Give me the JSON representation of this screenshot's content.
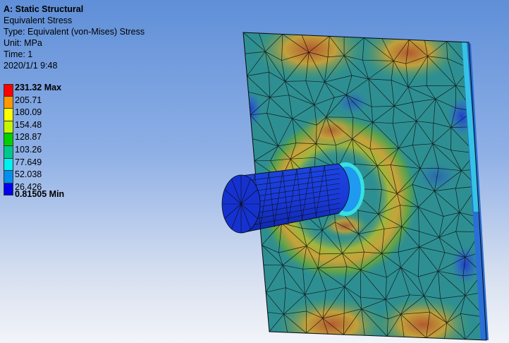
{
  "info": {
    "title": "A: Static Structural",
    "result": "Equivalent Stress",
    "type": "Type: Equivalent (von-Mises) Stress",
    "unit": "Unit: MPa",
    "time": "Time: 1",
    "timestamp": "2020/1/1 9:48"
  },
  "legend": {
    "max_label": "231.32 Max",
    "levels": [
      "205.71",
      "180.09",
      "154.48",
      "128.87",
      "103.26",
      "77.649",
      "52.038",
      "26.426"
    ],
    "min_label": "0.81505 Min",
    "colors": [
      "#ff0000",
      "#ff9900",
      "#ffff00",
      "#c6f500",
      "#00d000",
      "#00c88c",
      "#00f0f0",
      "#0090f0",
      "#0000ee"
    ]
  },
  "model": {
    "plate_color": "#2e8f92",
    "hot_color": "#b85a2a",
    "warm_color": "#6fae3c",
    "cold_color": "#2c5fc8",
    "cylinder_color": "#1a3ad8",
    "edge_color": "#0a0a0a"
  }
}
